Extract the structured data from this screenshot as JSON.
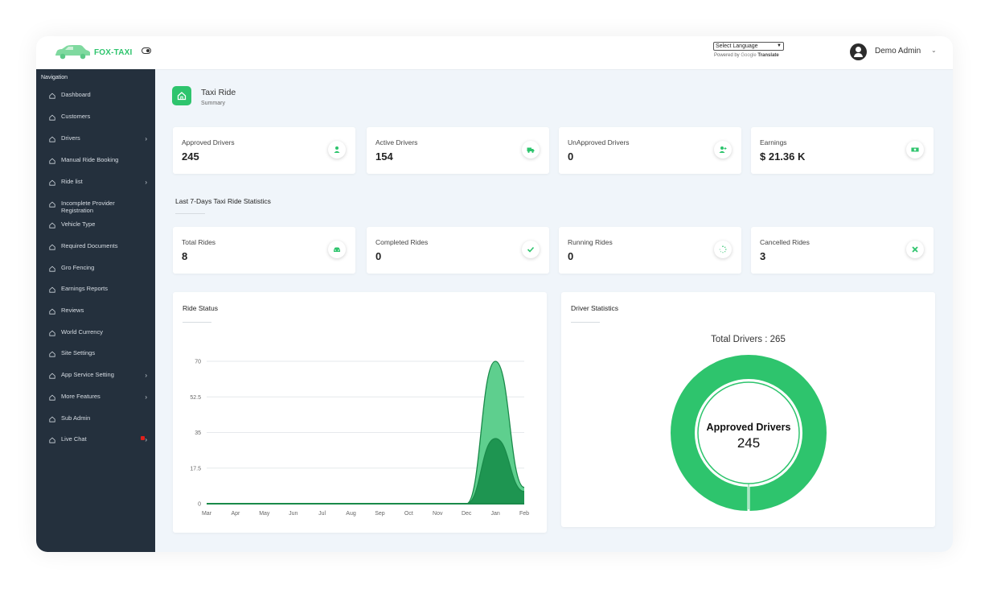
{
  "header": {
    "logo_text": "FOX-TAXI",
    "language_select": "Select Language",
    "powered_by": "Powered by",
    "google": "Google",
    "translate": "Translate",
    "admin_name": "Demo Admin"
  },
  "sidebar": {
    "title": "Navigation",
    "items": [
      {
        "label": "Dashboard",
        "chevron": false
      },
      {
        "label": "Customers",
        "chevron": false
      },
      {
        "label": "Drivers",
        "chevron": true
      },
      {
        "label": "Manual Ride Booking",
        "chevron": false
      },
      {
        "label": "Ride list",
        "chevron": true
      },
      {
        "label": "Incomplete Provider Registration",
        "chevron": false
      },
      {
        "label": "Vehicle Type",
        "chevron": false
      },
      {
        "label": "Required Documents",
        "chevron": false
      },
      {
        "label": "Gro Fencing",
        "chevron": false
      },
      {
        "label": "Earnings Reports",
        "chevron": false
      },
      {
        "label": "Reviews",
        "chevron": false
      },
      {
        "label": "World Currency",
        "chevron": false
      },
      {
        "label": "Site Settings",
        "chevron": false
      },
      {
        "label": "App Service Setting",
        "chevron": true
      },
      {
        "label": "More Features",
        "chevron": true
      },
      {
        "label": "Sub Admin",
        "chevron": false
      },
      {
        "label": "Live Chat",
        "chevron": true,
        "badge": true
      }
    ]
  },
  "page": {
    "title": "Taxi Ride",
    "subtitle": "Summary"
  },
  "stats_top": [
    {
      "label": "Approved Drivers",
      "value": "245",
      "icon": "user-icon"
    },
    {
      "label": "Active Drivers",
      "value": "154",
      "icon": "truck-icon"
    },
    {
      "label": "UnApproved Drivers",
      "value": "0",
      "icon": "user-plus-icon"
    },
    {
      "label": "Earnings",
      "value": "$ 21.36 K",
      "icon": "money-icon"
    }
  ],
  "section": {
    "title": "Last 7-Days Taxi Ride Statistics"
  },
  "stats_rides": [
    {
      "label": "Total Rides",
      "value": "8",
      "icon": "car-icon"
    },
    {
      "label": "Completed Rides",
      "value": "0",
      "icon": "check-icon"
    },
    {
      "label": "Running Rides",
      "value": "0",
      "icon": "spinner-icon"
    },
    {
      "label": "Cancelled Rides",
      "value": "3",
      "icon": "close-icon"
    }
  ],
  "ride_status": {
    "title": "Ride Status"
  },
  "driver_stats": {
    "title": "Driver Statistics",
    "total_label": "Total Drivers :",
    "total_value": "265",
    "center_label": "Approved Drivers",
    "center_value": "245"
  },
  "colors": {
    "accent": "#2ec46d",
    "sidebar": "#24303d",
    "area_light": "#5ecf8e",
    "area_dark": "#1e9551"
  },
  "chart_data": [
    {
      "type": "area",
      "title": "Ride Status",
      "categories": [
        "Mar",
        "Apr",
        "May",
        "Jun",
        "Jul",
        "Aug",
        "Sep",
        "Oct",
        "Nov",
        "Dec",
        "Jan",
        "Feb"
      ],
      "ylim": [
        0,
        70
      ],
      "yticks": [
        "0",
        "17.5",
        "35",
        "52.5",
        "70"
      ],
      "grid": true,
      "series": [
        {
          "values": [
            0,
            0,
            0,
            0,
            0,
            0,
            0,
            0,
            0,
            0,
            70,
            8
          ],
          "color": "#5ecf8e"
        },
        {
          "values": [
            0,
            0,
            0,
            0,
            0,
            0,
            0,
            0,
            0,
            0,
            32,
            6
          ],
          "color": "#1e9551"
        }
      ]
    },
    {
      "type": "pie",
      "title": "Driver Statistics",
      "categories": [
        "Approved Drivers",
        "UnApproved Drivers"
      ],
      "values": [
        245,
        0
      ],
      "colors": [
        "#2ec46d",
        "#ffffff"
      ]
    }
  ]
}
